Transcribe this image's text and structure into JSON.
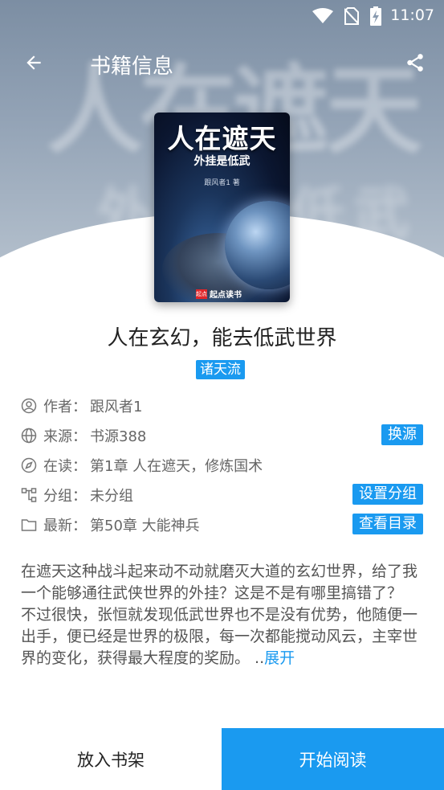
{
  "status_bar": {
    "time": "11:07"
  },
  "app_bar": {
    "title": "书籍信息"
  },
  "cover": {
    "title": "人在遮天",
    "subtitle": "外挂是低武",
    "author_line": "跟风者1 著",
    "publisher": "起点读书",
    "publisher_mark": "起点"
  },
  "hero_background_text": {
    "line1": "人在遮天",
    "line2": "外挂是低武"
  },
  "book": {
    "name": "人在玄幻，能去低武世界",
    "tag": "诸天流",
    "author_label": "作者：",
    "author": "跟风者1",
    "source_label": "来源：",
    "source": "书源388",
    "reading_label": "在读：",
    "reading": "第1章 人在遮天，修炼国术",
    "group_label": "分组：",
    "group": "未分组",
    "latest_label": "最新：",
    "latest": "第50章 大能神兵"
  },
  "actions": {
    "change_source": "换源",
    "set_group": "设置分组",
    "view_toc": "查看目录"
  },
  "description": {
    "p1": "在遮天这种战斗起来动不动就磨灭大道的玄幻世界，给了我一个能够通往武侠世界的外挂？这是不是有哪里搞错了？",
    "p2": "不过很快，张恒就发现低武世界也不是没有优势，他随便一出手，便已经是世界的极限，每一次都能搅动风云，主宰世界的变化，获得最大程度的奖励。 ..",
    "expand": "展开"
  },
  "bottom": {
    "add_shelf": "放入书架",
    "start_read": "开始阅读"
  },
  "colors": {
    "accent": "#1a9af0"
  }
}
